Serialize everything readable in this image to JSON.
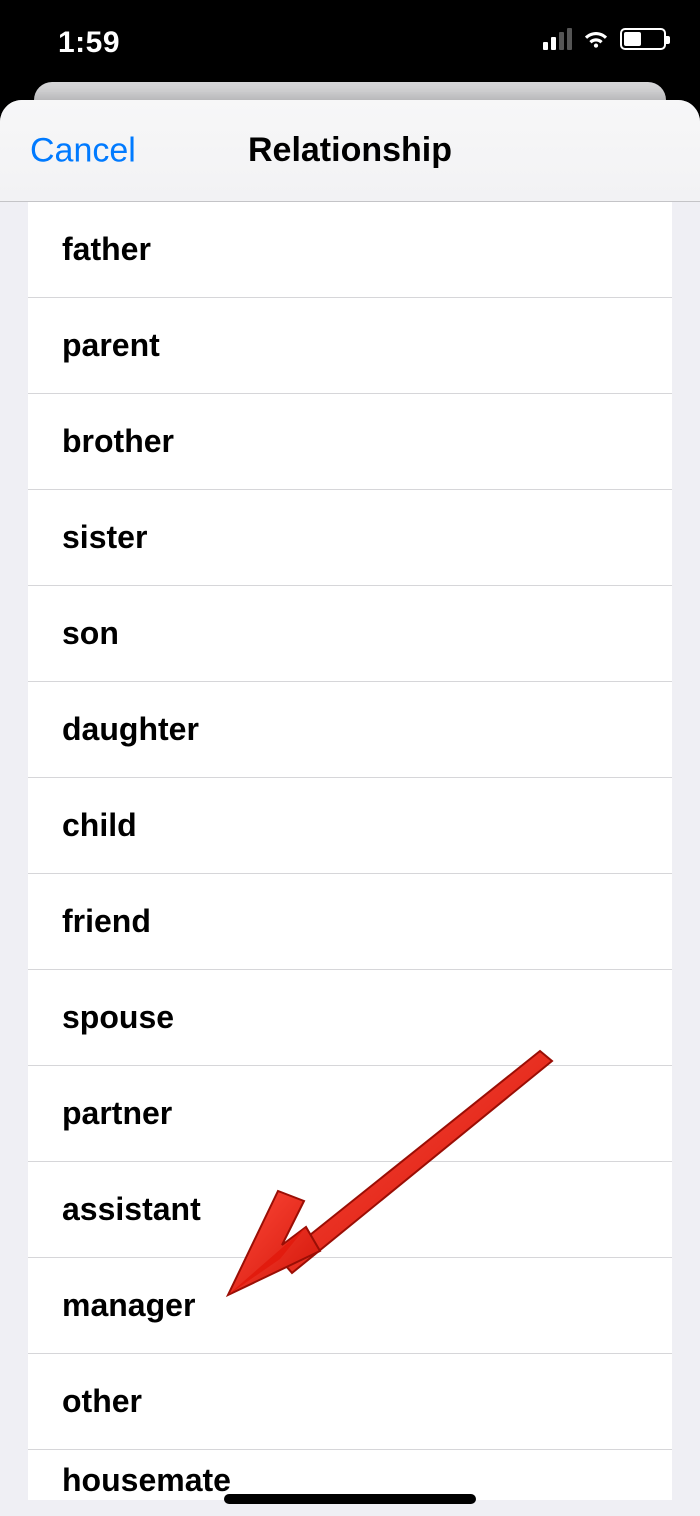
{
  "status": {
    "time": "1:59"
  },
  "nav": {
    "cancel": "Cancel",
    "title": "Relationship"
  },
  "rows": {
    "r0": "father",
    "r1": "parent",
    "r2": "brother",
    "r3": "sister",
    "r4": "son",
    "r5": "daughter",
    "r6": "child",
    "r7": "friend",
    "r8": "spouse",
    "r9": "partner",
    "r10": "assistant",
    "r11": "manager",
    "r12": "other",
    "r13": "housemate"
  },
  "annotation": {
    "arrow_color": "#ff2a1c",
    "target_row": "manager"
  }
}
